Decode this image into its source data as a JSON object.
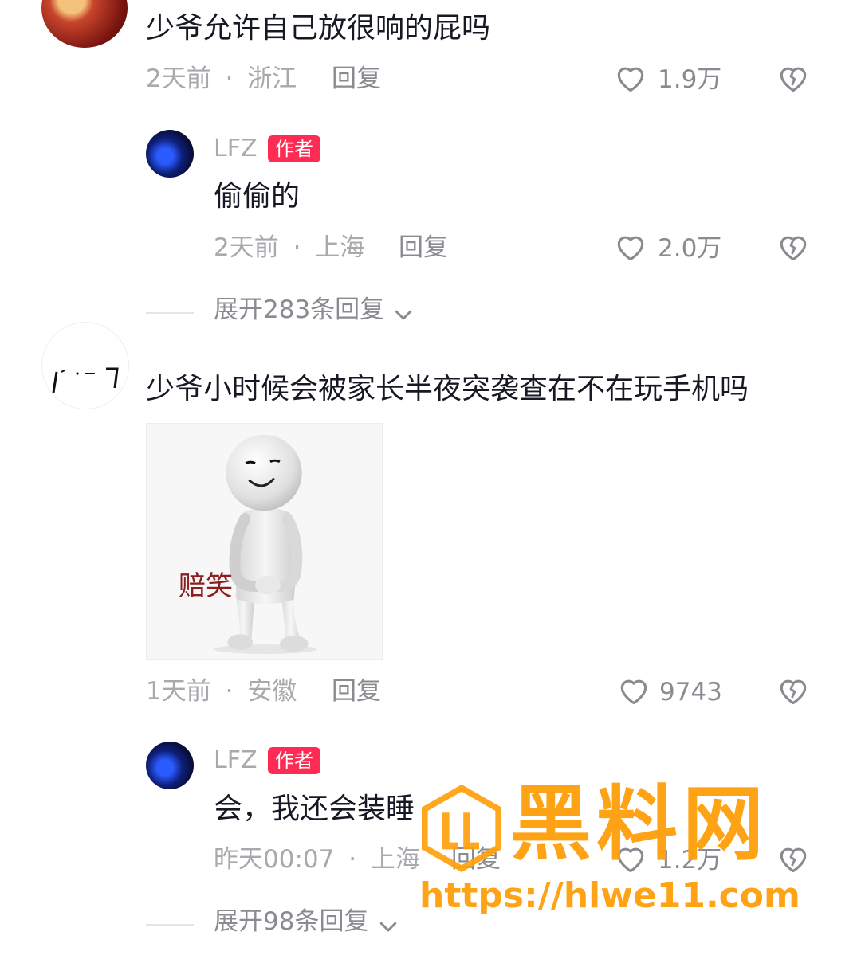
{
  "comments": [
    {
      "text": "少爷允许自己放很响的屁吗",
      "time": "2天前",
      "location": "浙江",
      "reply_label": "回复",
      "likes": "1.9万",
      "reply": {
        "nickname": "LFZ",
        "badge": "作者",
        "text": "偷偷的",
        "time": "2天前",
        "location": "上海",
        "reply_label": "回复",
        "likes": "2.0万"
      },
      "expand_label": "展开283条回复"
    },
    {
      "text": "少爷小时候会被家长半夜突袭查在不在玩手机吗",
      "sticker_caption": "赔笑",
      "time": "1天前",
      "location": "安徽",
      "reply_label": "回复",
      "likes": "9743",
      "reply": {
        "nickname": "LFZ",
        "badge": "作者",
        "text": "会，我还会装睡",
        "time": "昨天00:07",
        "location": "上海",
        "reply_label": "回复",
        "likes": "1.2万"
      },
      "expand_label": "展开98条回复"
    }
  ],
  "separator": "·",
  "watermark": {
    "title": "黑料网",
    "url": "https://hlwe11.com"
  },
  "icons": {
    "like": "heart-outline-icon",
    "dislike": "broken-heart-icon",
    "expand": "chevron-down-icon"
  },
  "colors": {
    "badge": "#fe2c55",
    "watermark": "#ff9f0a"
  }
}
